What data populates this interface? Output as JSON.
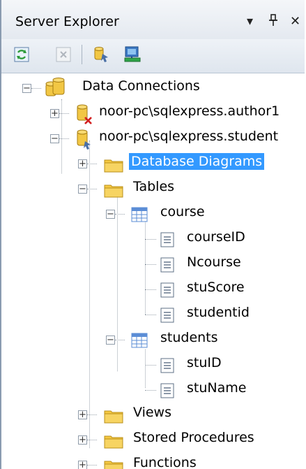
{
  "window": {
    "title": "Server Explorer",
    "dropdown_glyph": "▾",
    "pin_glyph": "ꟻ",
    "close_glyph": "✕"
  },
  "toolbar": {
    "buttons": [
      {
        "name": "refresh-icon"
      },
      {
        "name": "stop-refresh-icon"
      },
      {
        "name": "connect-to-database-icon"
      },
      {
        "name": "connect-to-server-icon"
      }
    ]
  },
  "tree": {
    "data_connections": "Data Connections",
    "conn_author": "noor-pc\\sqlexpress.author1",
    "conn_student": "noor-pc\\sqlexpress.student",
    "database_diagrams": "Database Diagrams",
    "tables": "Tables",
    "course": "course",
    "course_columns": [
      "courseID",
      "Ncourse",
      "stuScore",
      "studentid"
    ],
    "students": "students",
    "students_columns": [
      "stuID",
      "stuName"
    ],
    "views": "Views",
    "stored_procedures": "Stored Procedures",
    "functions": "Functions"
  },
  "colors": {
    "selection": "#3399ff",
    "folder": "#f5c842",
    "table_icon": "#5b8dd6"
  }
}
